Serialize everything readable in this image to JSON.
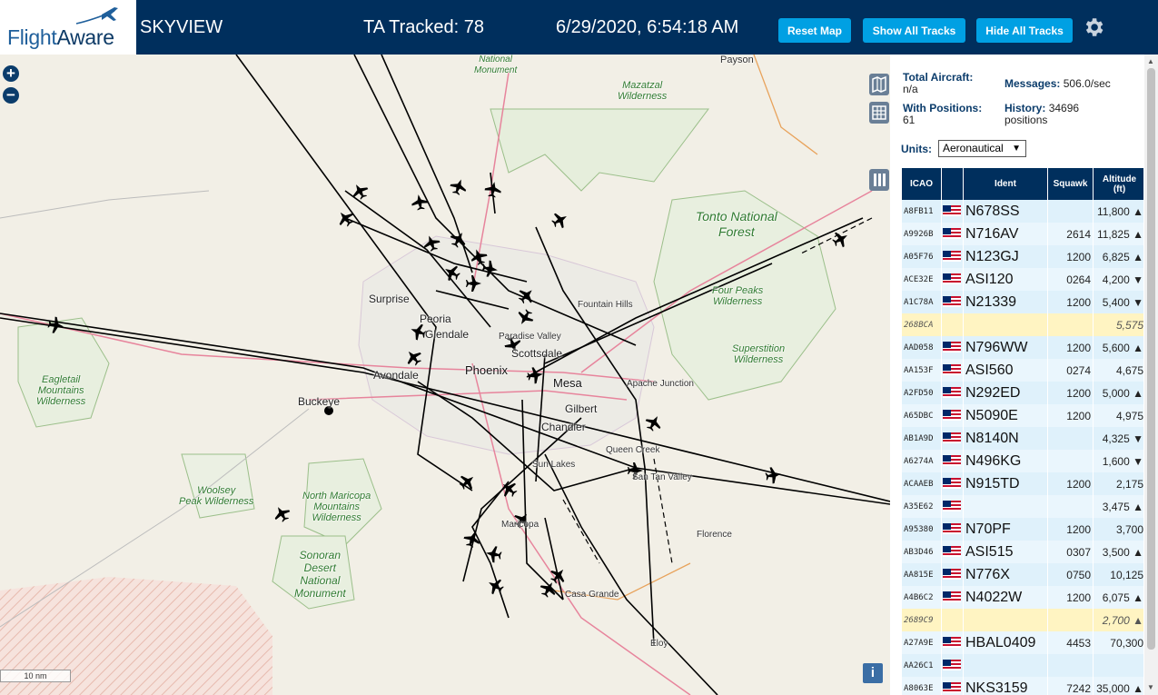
{
  "header": {
    "logo": "FlightAware",
    "logo_part1": "Flight",
    "logo_part2": "Aware",
    "app_name": "SKYVIEW",
    "tracked": "TA Tracked: 78",
    "datetime": "6/29/2020, 6:54:18 AM",
    "reset_label": "Reset Map",
    "show_label": "Show All Tracks",
    "hide_label": "Hide All Tracks",
    "settings_icon": "gear-icon"
  },
  "colors": {
    "header_bg": "#002f5d",
    "button_bg": "#00a0e3",
    "row_bg": "#dff1fb",
    "row_highlight": "#fff4c2",
    "map_bg": "#f2efe6",
    "park_green": "#2f7a2f",
    "track_black": "#000000"
  },
  "map": {
    "zoom_in": "+",
    "zoom_out": "−",
    "scale": "10 nm",
    "info": "i",
    "labels": {
      "payson": "Payson",
      "surprise": "Surprise",
      "peoria": "Peoria",
      "glendale": "Glendale",
      "avondale": "Avondale",
      "phoenix": "Phoenix",
      "buckeye": "Buckeye",
      "mesa": "Mesa",
      "scottsdale": "Scottsdale",
      "paradise_valley": "Paradise Valley",
      "fountain_hills": "Fountain Hills",
      "apache_junction": "Apache Junction",
      "gilbert": "Gilbert",
      "chandler": "Chandler",
      "queen_creek": "Queen Creek",
      "san_tan_valley": "San Tan Valley",
      "sun_lakes": "Sun Lakes",
      "maricopa": "Maricopa",
      "florence": "Florence",
      "casa_grande": "Casa Grande",
      "eloy": "Eloy",
      "national_monument_top_1": "National",
      "national_monument_top_2": "Monument",
      "mazatzal_1": "Mazatzal",
      "mazatzal_2": "Wilderness",
      "tonto_1": "Tonto National",
      "tonto_2": "Forest",
      "four_peaks_1": "Four Peaks",
      "four_peaks_2": "Wilderness",
      "superstition_1": "Superstition",
      "superstition_2": "Wilderness",
      "eagletail_1": "Eagletail",
      "eagletail_2": "Mountains",
      "eagletail_3": "Wilderness",
      "woolsey_1": "Woolsey",
      "woolsey_2": "Peak Wilderness",
      "north_maricopa_1": "North Maricopa",
      "north_maricopa_2": "Mountains",
      "north_maricopa_3": "Wilderness",
      "sonoran_1": "Sonoran",
      "sonoran_2": "Desert",
      "sonoran_3": "National",
      "sonoran_4": "Monument"
    }
  },
  "stats": {
    "total_label": "Total Aircraft:",
    "total_value": "n/a",
    "messages_label": "Messages:",
    "messages_value": "506.0/sec",
    "positions_label": "With Positions:",
    "positions_value": "61",
    "history_label": "History:",
    "history_value": "34696",
    "history_unit": "positions"
  },
  "units": {
    "label": "Units:",
    "selected": "Aeronautical"
  },
  "table": {
    "headers": {
      "icao": "ICAO",
      "ident": "Ident",
      "squawk": "Squawk",
      "altitude": "Altitude",
      "altitude_unit": "(ft)"
    },
    "rows": [
      {
        "icao": "A8FB11",
        "ident": "N678SS",
        "squawk": "",
        "alt": "11,800 ▲",
        "flag": true,
        "hl": false
      },
      {
        "icao": "A9926B",
        "ident": "N716AV",
        "squawk": "2614",
        "alt": "11,825 ▲",
        "flag": true,
        "hl": false
      },
      {
        "icao": "A05F76",
        "ident": "N123GJ",
        "squawk": "1200",
        "alt": "6,825 ▲",
        "flag": true,
        "hl": false
      },
      {
        "icao": "ACE32E",
        "ident": "ASI120",
        "squawk": "0264",
        "alt": "4,200 ▼",
        "flag": true,
        "hl": false
      },
      {
        "icao": "A1C78A",
        "ident": "N21339",
        "squawk": "1200",
        "alt": "5,400 ▼",
        "flag": true,
        "hl": false
      },
      {
        "icao": "268BCA",
        "ident": "",
        "squawk": "",
        "alt": "5,575",
        "flag": false,
        "hl": true
      },
      {
        "icao": "AAD058",
        "ident": "N796WW",
        "squawk": "1200",
        "alt": "5,600 ▲",
        "flag": true,
        "hl": false
      },
      {
        "icao": "AA153F",
        "ident": "ASI560",
        "squawk": "0274",
        "alt": "4,675",
        "flag": true,
        "hl": false
      },
      {
        "icao": "A2FD50",
        "ident": "N292ED",
        "squawk": "1200",
        "alt": "5,000 ▲",
        "flag": true,
        "hl": false
      },
      {
        "icao": "A65DBC",
        "ident": "N5090E",
        "squawk": "1200",
        "alt": "4,975",
        "flag": true,
        "hl": false
      },
      {
        "icao": "AB1A9D",
        "ident": "N8140N",
        "squawk": "",
        "alt": "4,325 ▼",
        "flag": true,
        "hl": false
      },
      {
        "icao": "A6274A",
        "ident": "N496KG",
        "squawk": "",
        "alt": "1,600 ▼",
        "flag": true,
        "hl": false
      },
      {
        "icao": "ACAAEB",
        "ident": "N915TD",
        "squawk": "1200",
        "alt": "2,175",
        "flag": true,
        "hl": false
      },
      {
        "icao": "A35E62",
        "ident": "",
        "squawk": "",
        "alt": "3,475 ▲",
        "flag": true,
        "hl": false
      },
      {
        "icao": "A95380",
        "ident": "N70PF",
        "squawk": "1200",
        "alt": "3,700",
        "flag": true,
        "hl": false
      },
      {
        "icao": "AB3D46",
        "ident": "ASI515",
        "squawk": "0307",
        "alt": "3,500 ▲",
        "flag": true,
        "hl": false
      },
      {
        "icao": "AA815E",
        "ident": "N776X",
        "squawk": "0750",
        "alt": "10,125",
        "flag": true,
        "hl": false
      },
      {
        "icao": "A4B6C2",
        "ident": "N4022W",
        "squawk": "1200",
        "alt": "6,075 ▲",
        "flag": true,
        "hl": false
      },
      {
        "icao": "2689C9",
        "ident": "",
        "squawk": "",
        "alt": "2,700 ▲",
        "flag": false,
        "hl": true
      },
      {
        "icao": "A27A9E",
        "ident": "HBAL0409",
        "squawk": "4453",
        "alt": "70,300",
        "flag": true,
        "hl": false
      },
      {
        "icao": "AA26C1",
        "ident": "",
        "squawk": "",
        "alt": "",
        "flag": true,
        "hl": false
      },
      {
        "icao": "A8063E",
        "ident": "NKS3159",
        "squawk": "7242",
        "alt": "35,000 ▲",
        "flag": true,
        "hl": false
      }
    ]
  }
}
